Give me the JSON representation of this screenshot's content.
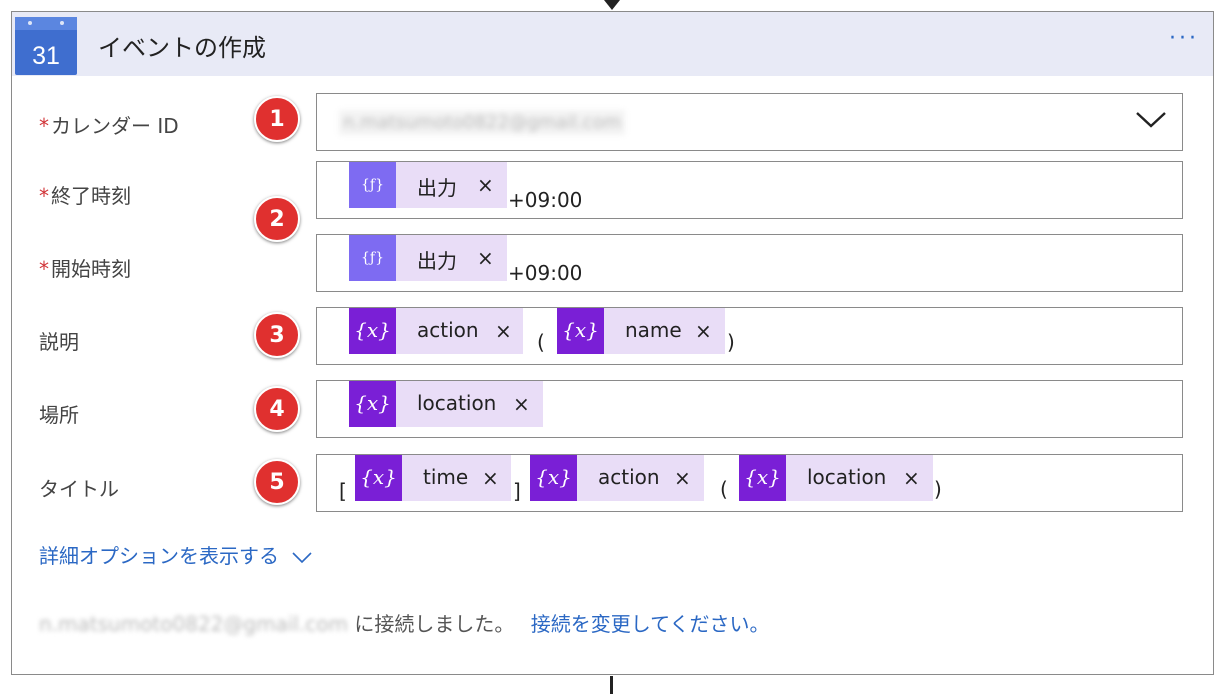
{
  "header": {
    "title": "イベントの作成",
    "more": "···"
  },
  "fields": {
    "calendar": {
      "label": "カレンダー ID",
      "required": true,
      "badge": "1",
      "value": "n.matsumoto0822@gmail.com"
    },
    "end_time": {
      "label": "終了時刻",
      "required": true,
      "token": "出力",
      "suffix": "+09:00"
    },
    "start_time": {
      "label": "開始時刻",
      "required": true,
      "token": "出力",
      "suffix": "+09:00"
    },
    "time_badge": "2",
    "description": {
      "label": "説明",
      "badge": "3",
      "token1": "action",
      "open": "(",
      "token2": "name",
      "close": ")"
    },
    "location": {
      "label": "場所",
      "badge": "4",
      "token": "location"
    },
    "title": {
      "label": "タイトル",
      "badge": "5",
      "open_bracket": "[",
      "token1": "time",
      "close_bracket": "]",
      "token2": "action",
      "open": "(",
      "token3": "location",
      "close": ")"
    }
  },
  "required_mark": "*",
  "close_symbol": "×",
  "var_icon_symbol": "{x}",
  "expr_icon_symbol": "{ƒ}",
  "calendar_icon_number": "31",
  "advanced_options": "詳細オプションを表示する",
  "connection": {
    "email": "n.matsumoto0822@gmail.com",
    "text": "に接続しました。",
    "change_link": "接続を変更してください。"
  },
  "colors": {
    "header_bg": "#e8eaf6",
    "badge": "#e0302f",
    "link": "#2b68c4",
    "var_token": "#7a1fd6",
    "expr_token": "#7e6bf2",
    "token_bg": "#e9ddf7"
  }
}
